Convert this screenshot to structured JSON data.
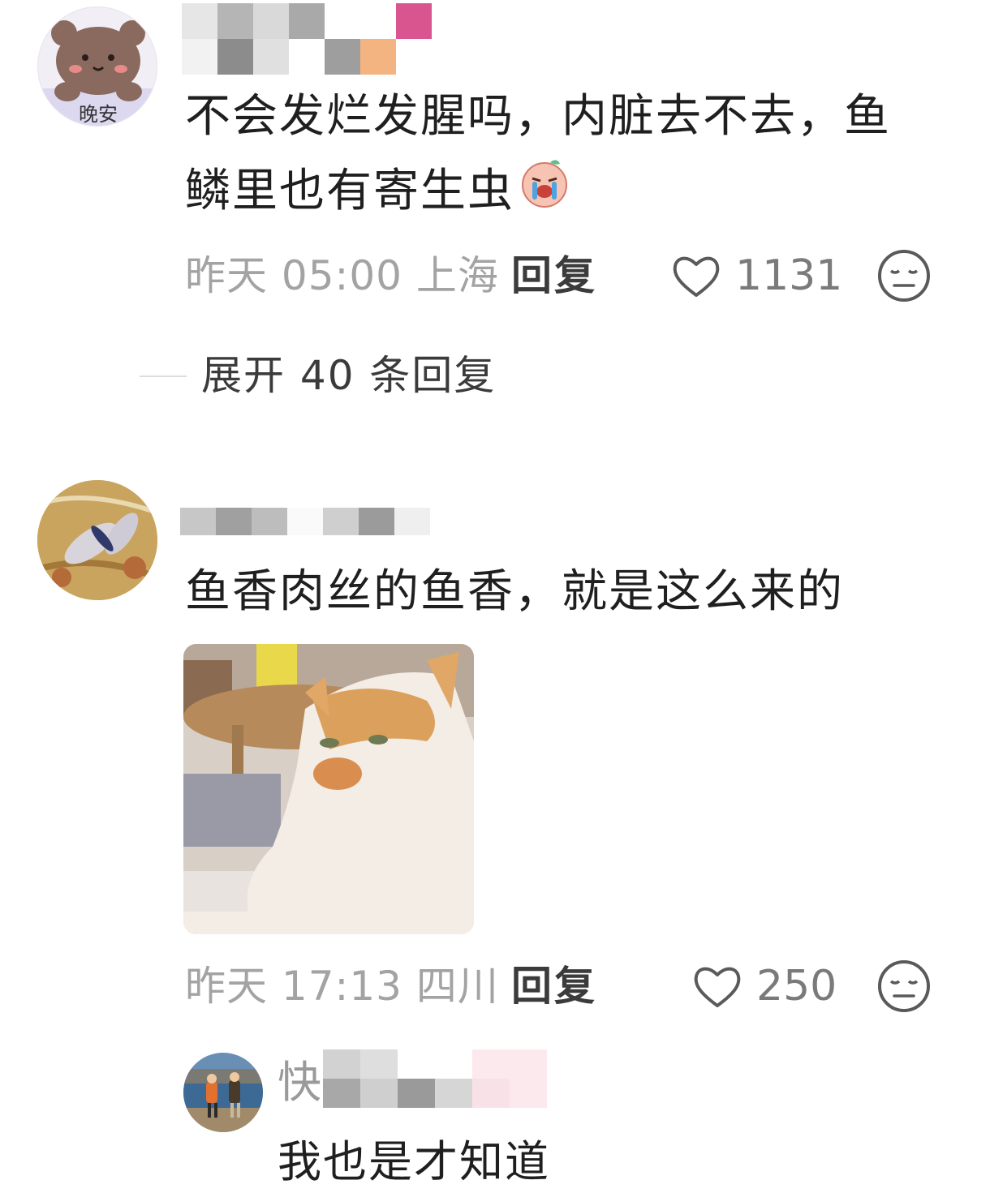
{
  "comments": [
    {
      "avatar_label": "晚安",
      "text_line1": "不会发烂发腥吗，内脏去不去，鱼",
      "text_line2": "鳞里也有寄生虫",
      "emoji": "crying-face-sticker",
      "time": "昨天 05:00",
      "location": "上海",
      "reply_label": "回复",
      "likes": "1131",
      "expand_label": "展开 40 条回复"
    },
    {
      "text": "鱼香肉丝的鱼香，就是这么来的",
      "image": "cat-photo",
      "time": "昨天 17:13",
      "location": "四川",
      "reply_label": "回复",
      "likes": "250",
      "sub_reply": {
        "username_prefix": "快",
        "text": "我也是才知道"
      }
    }
  ],
  "colors": {
    "meta_gray": "#a3a3a3",
    "text": "#1f1f1f",
    "icon_gray": "#5a5a5a"
  }
}
